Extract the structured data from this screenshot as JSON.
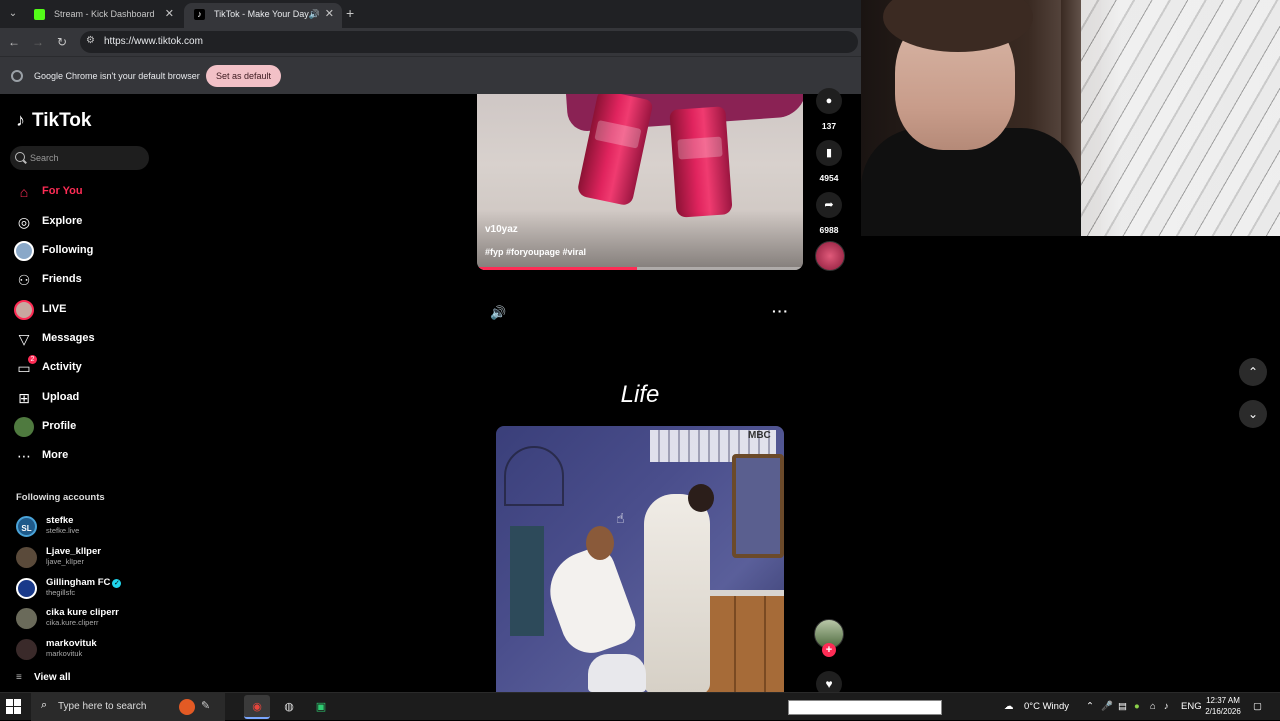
{
  "browser": {
    "tabs": [
      {
        "title": "Stream - Kick Dashboard",
        "favicon_color": "#53fc18",
        "active": false
      },
      {
        "title": "TikTok - Make Your Day",
        "favicon_color": "#000000",
        "active": true
      }
    ],
    "url": "https://www.tiktok.com",
    "infobar": {
      "message": "Google Chrome isn't your default browser",
      "button": "Set as default"
    }
  },
  "sidebar": {
    "brand": "TikTok",
    "search_placeholder": "Search",
    "nav": [
      {
        "label": "For You",
        "icon": "home-icon",
        "active": true
      },
      {
        "label": "Explore",
        "icon": "compass-icon"
      },
      {
        "label": "Following",
        "icon": "following-avatar-icon"
      },
      {
        "label": "Friends",
        "icon": "friends-icon"
      },
      {
        "label": "LIVE",
        "icon": "live-avatar-icon"
      },
      {
        "label": "Messages",
        "icon": "paper-plane-icon"
      },
      {
        "label": "Activity",
        "icon": "activity-inbox-icon",
        "badge": "2"
      },
      {
        "label": "Upload",
        "icon": "upload-plus-icon"
      },
      {
        "label": "Profile",
        "icon": "profile-avatar-icon"
      },
      {
        "label": "More",
        "icon": "more-dots-icon"
      }
    ],
    "following_title": "Following accounts",
    "accounts": [
      {
        "name": "stefke",
        "handle": "stefke.live",
        "avatar_text": "SL"
      },
      {
        "name": "Ljave_klIper",
        "handle": "ljave_klIper"
      },
      {
        "name": "Gillingham FC",
        "handle": "thegillsfc",
        "verified": true
      },
      {
        "name": "cika kure cliperr",
        "handle": "cika.kure.cliperr"
      },
      {
        "name": "markovituk",
        "handle": "markovituk"
      }
    ],
    "view_all": "View all"
  },
  "feed": {
    "video1": {
      "author": "v10yaz",
      "description": "#fyp #foryoupage #viral",
      "progress": 0.49,
      "comments": "137",
      "saves": "4954",
      "shares": "6988"
    },
    "video2": {
      "caption": "Life",
      "watermark": "MBC"
    }
  },
  "taskbar": {
    "search_placeholder": "Type here to search",
    "weather": "0°C  Windy",
    "language": "ENG",
    "time": "12:37 AM",
    "date": "2/16/2026"
  },
  "colors": {
    "accent": "#fe2c55",
    "background": "#000000"
  }
}
